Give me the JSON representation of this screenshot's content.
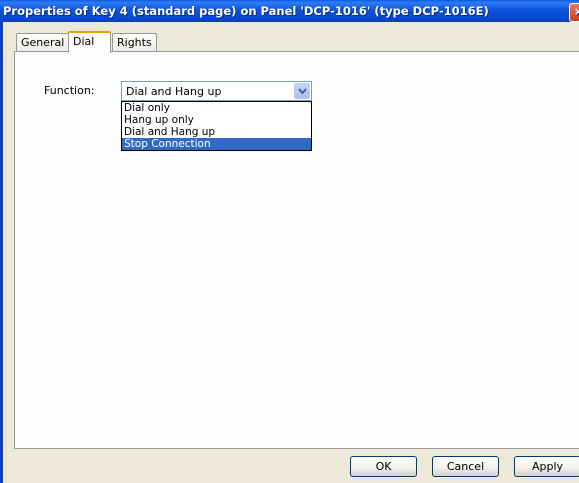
{
  "window": {
    "title": "Properties of Key 4 (standard page) on Panel 'DCP-1016' (type DCP-1016E)",
    "close_glyph": "×"
  },
  "tabs": [
    {
      "label": "General"
    },
    {
      "label": "Dial"
    },
    {
      "label": "Rights"
    }
  ],
  "form": {
    "function_label": "Function:",
    "function_value": "Dial and Hang up",
    "options": [
      "Dial only",
      "Hang up only",
      "Dial and Hang up",
      "Stop Connection"
    ],
    "highlighted_option": "Stop Connection"
  },
  "buttons": {
    "ok": "OK",
    "cancel": "Cancel",
    "apply": "Apply"
  },
  "colors": {
    "titlebar": "#0b53dc",
    "selection": "#316ac5",
    "active_tab_accent": "#f0a000"
  }
}
